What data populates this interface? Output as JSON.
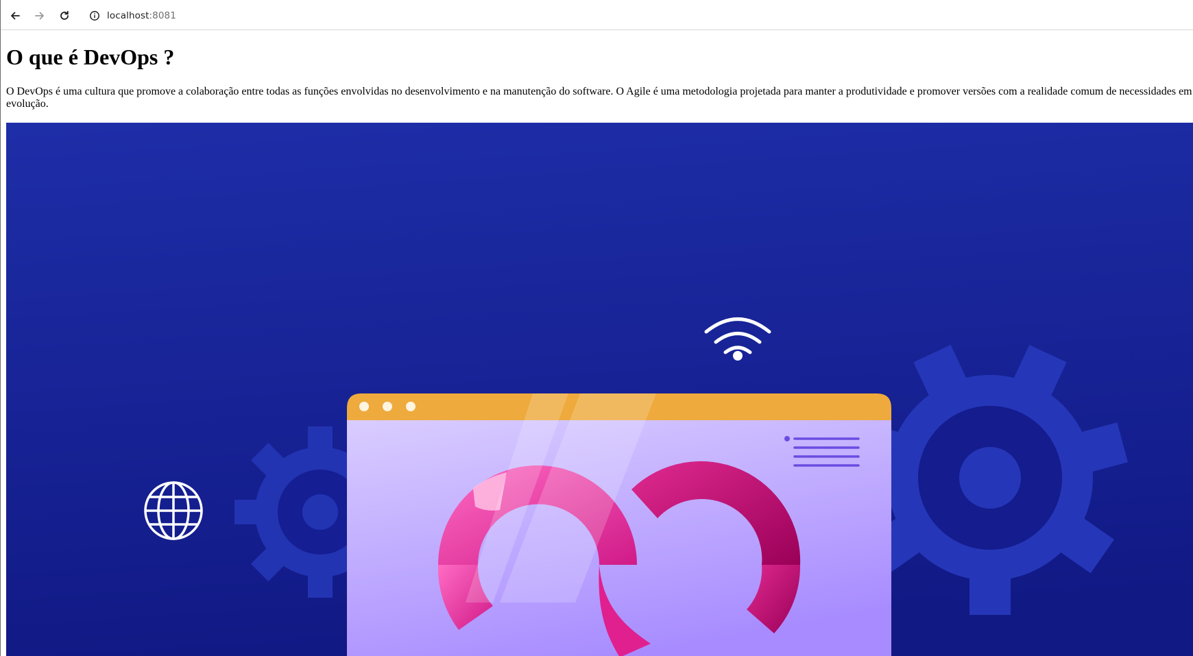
{
  "browser": {
    "url_host": "localhost",
    "url_port": ":8081",
    "icons": {
      "back": "arrow-left-icon",
      "forward": "arrow-right-icon",
      "reload": "reload-icon",
      "site_info": "info-icon"
    }
  },
  "page": {
    "title": "O que é DevOps ?",
    "intro": "O DevOps é uma cultura que promove a colaboração entre todas as funções envolvidas no desenvolvimento e na manutenção do software. O Agile é uma metodologia projetada para manter a produtividade e promover versões com a realidade comum de necessidades em evolução."
  },
  "illustration": {
    "subject": "devops-infinity-illustration",
    "colors": {
      "background_top": "#1e2ea8",
      "background_bottom": "#121a8a",
      "gear": "#2a3cc0",
      "window_bar": "#f0aa3a",
      "window_body_top": "#d8ccff",
      "window_body_bottom": "#a88cff",
      "infinity_light": "#f45cb8",
      "infinity_dark": "#b8006a",
      "icon_stroke": "#ffffff",
      "lines": "#6a4de0"
    }
  }
}
